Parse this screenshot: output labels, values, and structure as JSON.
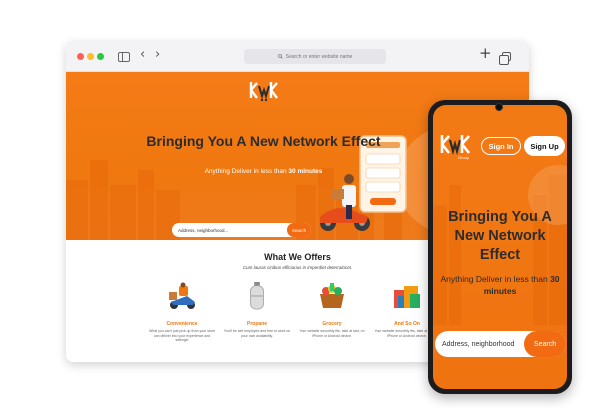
{
  "browser": {
    "address_placeholder": "Search or enter website name",
    "icons": [
      "close-dot",
      "minimize-dot",
      "maximize-dot",
      "sidebar-icon",
      "back-icon",
      "forward-icon",
      "search-icon",
      "new-tab-icon",
      "tabs-overview-icon"
    ],
    "back_glyph": "‹",
    "forward_glyph": "›",
    "plus_glyph": "+"
  },
  "site": {
    "logo_text": "kwk",
    "hero_title": "Bringing You A New Network Effect",
    "hero_sub_prefix": "Anything Deliver in less than ",
    "hero_sub_bold": "30 minutes",
    "search_placeholder": "Address, neighborhood...",
    "search_button": "Search",
    "offers_title": "What We Offers",
    "offers_sub": "Cum lauras cinibus efficiarius in imperdiet deterralocet.",
    "offers": [
      {
        "name": "Convenience",
        "desc": "What you can't just pick up from your store can deliver into your experience and settings!"
      },
      {
        "name": "Propane",
        "desc": "You'll be self employed and free to work on your own availability."
      },
      {
        "name": "Grocery",
        "desc": "Your website smoothly fits, fake at last, on iPhone or Android device."
      },
      {
        "name": "And So On",
        "desc": "Your website smoothly fits, fake at last, on iPhone or Android device."
      }
    ],
    "colors": {
      "brand_orange": "#f0780f",
      "button_orange": "#f26a11",
      "title_dark": "#2c2c2c"
    }
  },
  "phone": {
    "logo_text": "kwk",
    "logo_sub": "Group",
    "signin": "Sign In",
    "signup": "Sign Up",
    "hero_title": "Bringing You A New Network Effect",
    "hero_sub_prefix": "Anything Deliver in less than ",
    "hero_sub_bold": "30",
    "hero_sub_suffix": "minutes",
    "search_placeholder": "Address, neighborhood",
    "search_button": "Search"
  }
}
